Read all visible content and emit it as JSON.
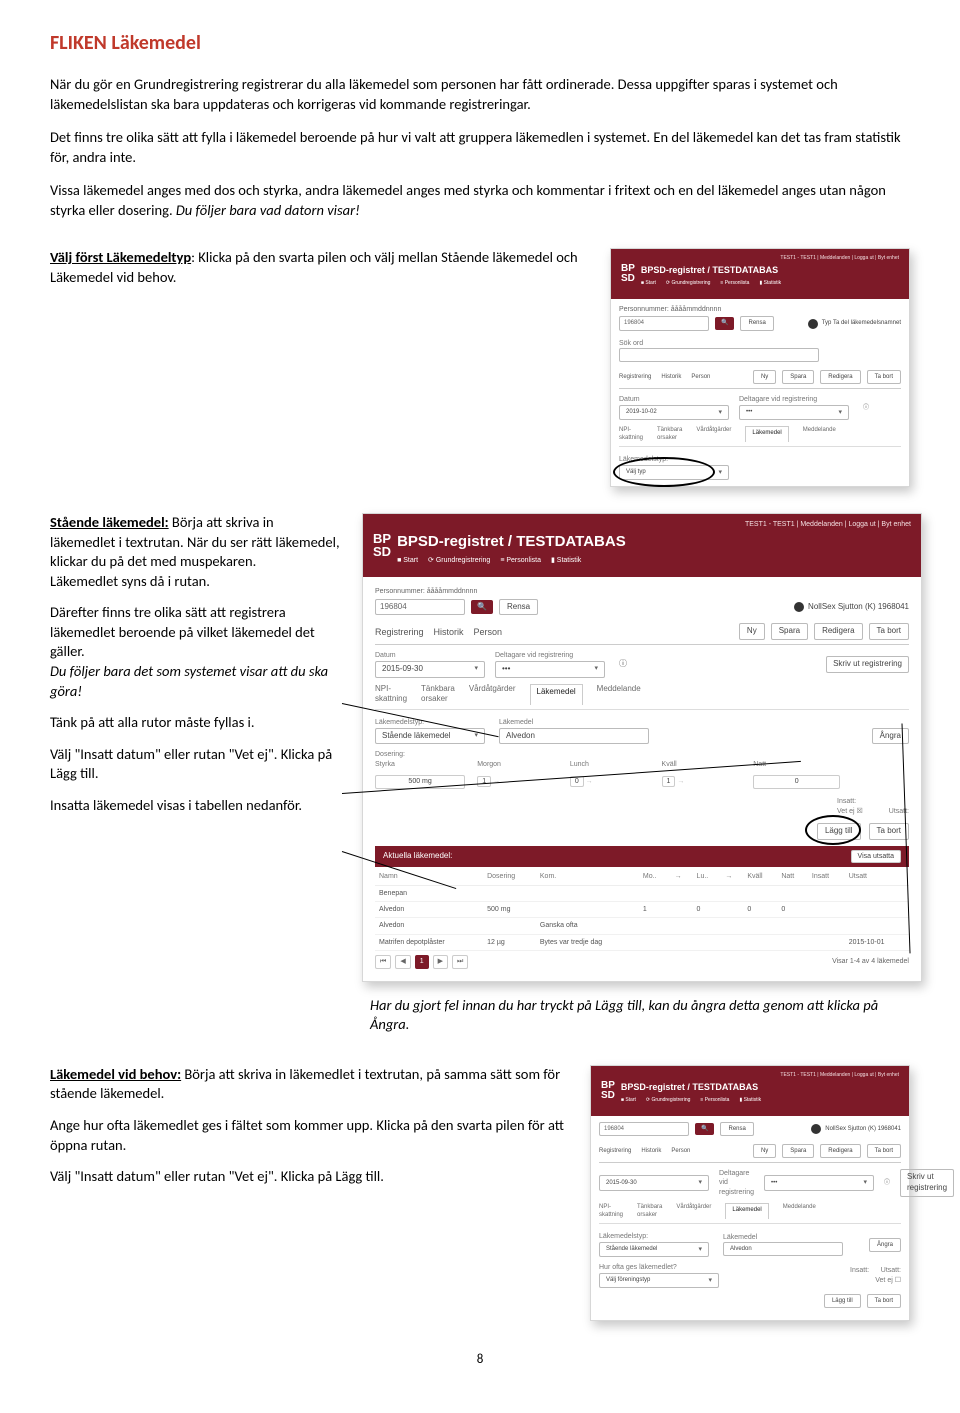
{
  "title": "FLIKEN Läkemedel",
  "intro1": "När du gör en Grundregistrering registrerar du alla läkemedel som personen har fått ordinerade. Dessa uppgifter sparas i systemet och läkemedelslistan ska bara uppdateras och korrigeras vid kommande registreringar.",
  "intro2": "Det finns tre olika sätt att fylla i läkemedel beroende på hur vi valt att gruppera läkemedlen i systemet. En del läkemedel kan det tas fram statistik för, andra inte.",
  "intro3a": "Vissa läkemedel anges med dos och styrka, andra läkemedel anges med styrka och kommentar i fritext och en del läkemedel anges utan någon styrka eller dosering. ",
  "intro3b": "Du följer bara vad datorn visar!",
  "step1_label": "Välj först Läkemedeltyp",
  "step1_rest": ": Klicka på den svarta pilen och välj mellan Stående läkemedel och Läkemedel vid behov.",
  "std_label": "Stående läkemedel:",
  "std_p1": " Börja att skriva in läkemedlet i textrutan. När du ser rätt läkemedel, klickar du på det med muspekaren.",
  "std_p1b": "Läkemedlet syns då i rutan.",
  "std_p2a": "Därefter finns tre olika sätt att registrera läkemedlet beroende på vilket läkemedel det gäller. ",
  "std_p2b": "Du följer bara det som systemet visar att du ska göra!",
  "std_p3": "Tänk på att alla rutor måste fyllas i.",
  "std_p4": "Välj \"Insatt datum\" eller rutan \"Vet ej\". Klicka på Lägg till.",
  "std_p5": "Insatta läkemedel visas i tabellen nedanför.",
  "postnote": "Har du gjort fel innan du har tryckt på Lägg till, kan du ångra detta genom att klicka på Ångra.",
  "bhv_label": "Läkemedel vid behov:",
  "bhv_p1": " Börja att skriva in läkemedlet i textrutan, på samma sätt som för stående läkemedel.",
  "bhv_p2": "Ange hur ofta läkemedlet ges i fältet som kommer upp. Klicka på den svarta pilen för att öppna rutan.",
  "bhv_p3": "Välj \"Insatt datum\" eller rutan \"Vet ej\". Klicka på Lägg till.",
  "page_num": "8",
  "mock": {
    "topright": "TEST1 - TEST1 | Meddelanden   | Logga ut | Byt enhet",
    "logo1": "BP",
    "logo2": "SD",
    "title": "BPSD-registret / TESTDATABAS",
    "nav_start": "Start",
    "nav_grund": "Grundregistrering",
    "nav_person": "Personlista",
    "nav_stat": "Statistik",
    "personnr_lbl": "Personnummer: ååååmmddnnnn",
    "personnr_val": "196804",
    "rensa": "Rensa",
    "user": "NollSex Sjutton (K) 1968041",
    "tabs_a": {
      "reg": "Registrering",
      "hist": "Historik",
      "pers": "Person"
    },
    "btns_a": {
      "ny": "Ny",
      "spara": "Spara",
      "red": "Redigera",
      "tabort": "Ta bort"
    },
    "datum_lbl": "Datum",
    "datum_val": "2015-09-30",
    "delt_lbl": "Deltagare vid registrering",
    "delt_dots": "•••",
    "skriv_ut": "Skriv ut registrering",
    "tabs_b": {
      "npi": "NPI-\nskattning",
      "tank": "Tänkbara\norsaker",
      "vard": "Vårdåtgärder",
      "lak": "Läkemedel",
      "med": "Meddelande"
    },
    "lakemedelstyp_lbl": "Läkemedelstyp:",
    "lakemedelstyp_val_staende": "Stående läkemedel",
    "lakemedelstyp_val_valj": "Välj typ",
    "lakemedelsnamn_lbl": "Läkemedel",
    "lakemedel_val": "Alvedon",
    "angra": "Ångra",
    "dosering_lbl": "Dosering:",
    "styrka_lbl": "Styrka",
    "styrka_val": "500 mg",
    "tid": {
      "morgon": "Morgon",
      "lunch": "Lunch",
      "kvall": "Kväll",
      "natt": "Natt"
    },
    "one": "1",
    "zero": "0",
    "insatt_lbl": "Insatt:",
    "utsatt_lbl": "Utsatt:",
    "vetej": "Vet ej",
    "laggtill": "Lägg till",
    "tabort2": "Ta bort",
    "aktuella": "Aktuella läkemedel:",
    "visa_utsatta": "Visa utsatta",
    "th": {
      "namn": "Namn",
      "dos": "Dosering",
      "kom": "Kom.",
      "mo": "Mo..",
      "lu": "Lu..",
      "kv": "Kväll",
      "na": "Natt",
      "ins": "Insatt",
      "uts": "Utsatt"
    },
    "rows": [
      {
        "namn": "Benepan",
        "dos": "",
        "kom": "",
        "mo": "",
        "lu": "",
        "kv": "",
        "na": "",
        "ins": "",
        "uts": ""
      },
      {
        "namn": "Alvedon",
        "dos": "500 mg",
        "kom": "",
        "mo": "1",
        "lu": "0",
        "kv": "0",
        "na": "0",
        "ins": "",
        "uts": ""
      },
      {
        "namn": "Alvedon",
        "dos": "",
        "kom": "Ganska ofta",
        "mo": "",
        "lu": "",
        "kv": "",
        "na": "",
        "ins": "",
        "uts": ""
      },
      {
        "namn": "Matrifen depotplåster",
        "dos": "12 µg",
        "kom": "Bytes var tredje dag",
        "mo": "",
        "lu": "",
        "kv": "",
        "na": "",
        "ins": "",
        "uts": "2015-10-01"
      }
    ],
    "pager_txt": "Visar 1-4 av 4 läkemedel",
    "small_date": "2015-09-30",
    "small_date2": "2019-10-02",
    "hur": "Hur ofta ges läkemedlet?",
    "valj_for": "Välj föreningstyp",
    "sok": "Sök ord",
    "sok_hint": "Typ Ta del läkemedelsnamnet"
  }
}
